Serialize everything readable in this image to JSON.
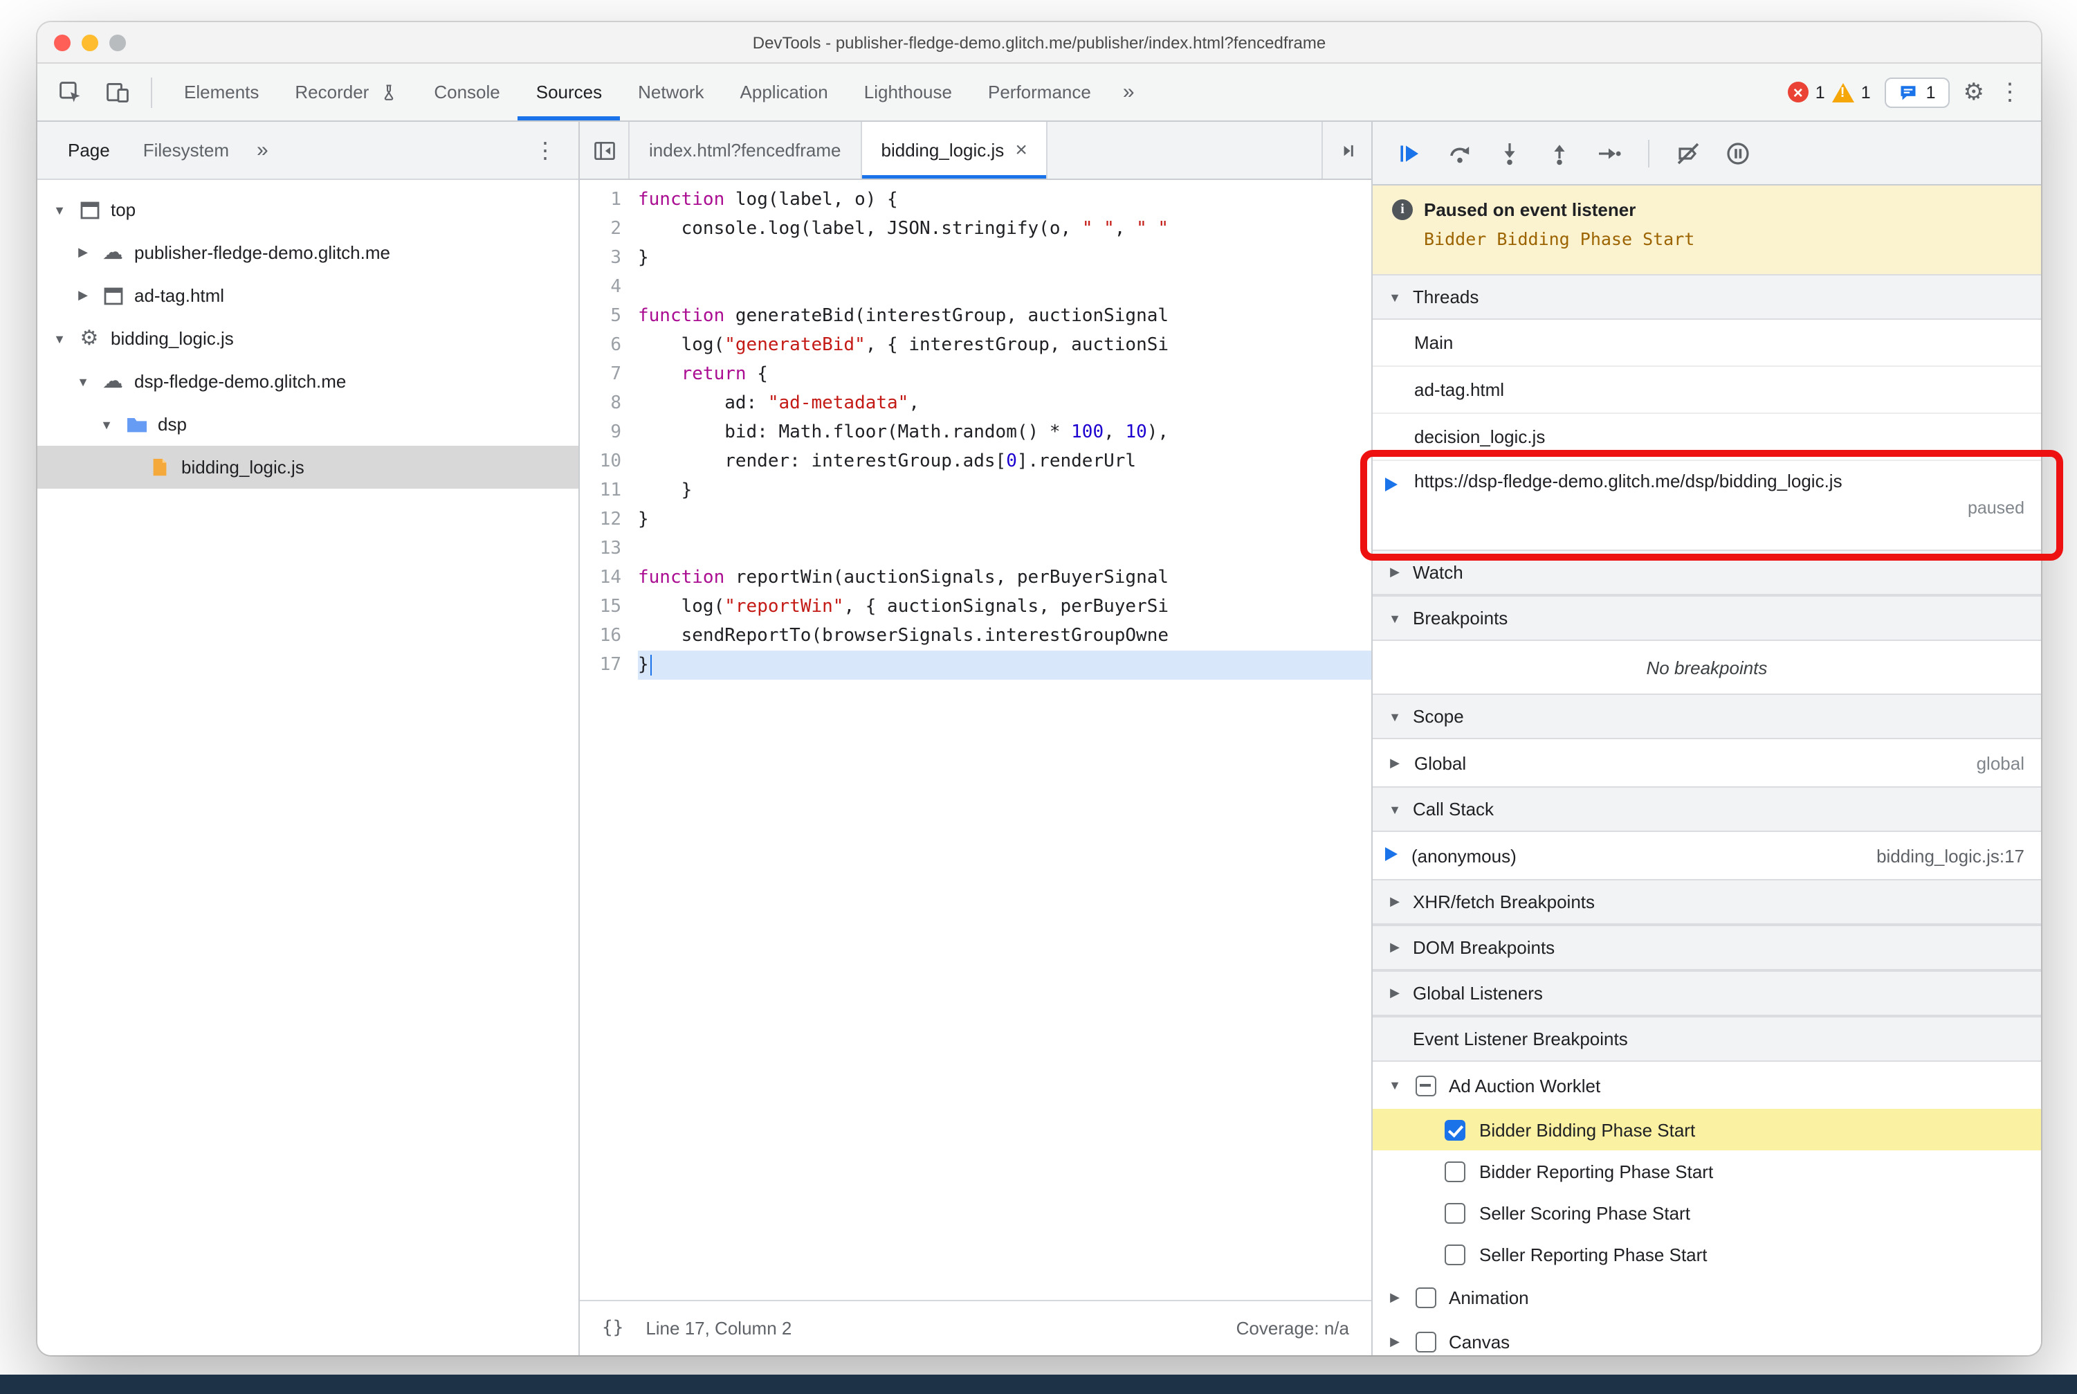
{
  "window": {
    "title": "DevTools - publisher-fledge-demo.glitch.me/publisher/index.html?fencedframe"
  },
  "icons": {
    "tri_down": "▼",
    "tri_right": "▶",
    "chevrons": "»",
    "kebab": "⋮",
    "close": "×",
    "cloud": "☁",
    "gear": "⚙",
    "braces": "{}"
  },
  "toolbar": {
    "tabs": [
      {
        "label": "Elements"
      },
      {
        "label": "Recorder"
      },
      {
        "label": "Console"
      },
      {
        "label": "Sources"
      },
      {
        "label": "Network"
      },
      {
        "label": "Application"
      },
      {
        "label": "Lighthouse"
      },
      {
        "label": "Performance"
      }
    ],
    "badges": {
      "errors": "1",
      "warnings": "1",
      "issues": "1"
    }
  },
  "navigator": {
    "tabs": [
      {
        "label": "Page"
      },
      {
        "label": "Filesystem"
      }
    ],
    "tree": [
      {
        "label": "top"
      },
      {
        "label": "publisher-fledge-demo.glitch.me"
      },
      {
        "label": "ad-tag.html"
      },
      {
        "label": "bidding_logic.js"
      },
      {
        "label": "dsp-fledge-demo.glitch.me"
      },
      {
        "label": "dsp"
      },
      {
        "label": "bidding_logic.js"
      }
    ]
  },
  "editor": {
    "tabs": [
      {
        "label": "index.html?fencedframe"
      },
      {
        "label": "bidding_logic.js"
      }
    ],
    "status": {
      "position": "Line 17, Column 2",
      "coverage": "Coverage: n/a"
    },
    "code": {
      "lines": [
        {
          "n": "1",
          "segs": [
            [
              "kw",
              "function"
            ],
            [
              "pl",
              " log(label, o) {"
            ]
          ]
        },
        {
          "n": "2",
          "segs": [
            [
              "pl",
              "    console.log(label, JSON.stringify(o, "
            ],
            [
              "str",
              "\" \""
            ],
            [
              "pl",
              ", "
            ],
            [
              "str",
              "\" \""
            ]
          ]
        },
        {
          "n": "3",
          "segs": [
            [
              "pl",
              "}"
            ]
          ]
        },
        {
          "n": "4",
          "segs": []
        },
        {
          "n": "5",
          "segs": [
            [
              "kw",
              "function"
            ],
            [
              "pl",
              " generateBid(interestGroup, auctionSignal"
            ]
          ]
        },
        {
          "n": "6",
          "segs": [
            [
              "pl",
              "    log("
            ],
            [
              "str",
              "\"generateBid\""
            ],
            [
              "pl",
              ", { interestGroup, auctionSi"
            ]
          ]
        },
        {
          "n": "7",
          "segs": [
            [
              "pl",
              "    "
            ],
            [
              "kw",
              "return"
            ],
            [
              "pl",
              " {"
            ]
          ]
        },
        {
          "n": "8",
          "segs": [
            [
              "pl",
              "        ad: "
            ],
            [
              "str",
              "\"ad-metadata\""
            ],
            [
              "pl",
              ","
            ]
          ]
        },
        {
          "n": "9",
          "segs": [
            [
              "pl",
              "        bid: Math.floor(Math.random() * "
            ],
            [
              "num",
              "100"
            ],
            [
              "pl",
              ", "
            ],
            [
              "num",
              "10"
            ],
            [
              "pl",
              "),"
            ]
          ]
        },
        {
          "n": "10",
          "segs": [
            [
              "pl",
              "        render: interestGroup.ads["
            ],
            [
              "num",
              "0"
            ],
            [
              "pl",
              "].renderUrl"
            ]
          ]
        },
        {
          "n": "11",
          "segs": [
            [
              "pl",
              "    }"
            ]
          ]
        },
        {
          "n": "12",
          "segs": [
            [
              "pl",
              "}"
            ]
          ]
        },
        {
          "n": "13",
          "segs": []
        },
        {
          "n": "14",
          "segs": [
            [
              "kw",
              "function"
            ],
            [
              "pl",
              " reportWin(auctionSignals, perBuyerSignal"
            ]
          ]
        },
        {
          "n": "15",
          "segs": [
            [
              "pl",
              "    log("
            ],
            [
              "str",
              "\"reportWin\""
            ],
            [
              "pl",
              ", { auctionSignals, perBuyerSi"
            ]
          ]
        },
        {
          "n": "16",
          "segs": [
            [
              "pl",
              "    sendReportTo(browserSignals.interestGroupOwne"
            ]
          ]
        },
        {
          "n": "17",
          "segs": [
            [
              "pl",
              "}"
            ]
          ],
          "hl": true
        }
      ]
    }
  },
  "sidebar": {
    "paused": {
      "title": "Paused on event listener",
      "reason": "Bidder Bidding Phase Start"
    },
    "threads": {
      "title": "Threads",
      "items": [
        {
          "label": "Main"
        },
        {
          "label": "ad-tag.html"
        },
        {
          "label": "decision_logic.js"
        }
      ],
      "active": {
        "url": "https://dsp-fledge-demo.glitch.me/dsp/bidding_logic.js",
        "status": "paused"
      }
    },
    "watch": {
      "title": "Watch"
    },
    "breakpoints": {
      "title": "Breakpoints",
      "empty": "No breakpoints"
    },
    "scope": {
      "title": "Scope",
      "global_label": "Global",
      "global_value": "global"
    },
    "callstack": {
      "title": "Call Stack",
      "frame": "(anonymous)",
      "location": "bidding_logic.js:17"
    },
    "xhr_title": "XHR/fetch Breakpoints",
    "dom_title": "DOM Breakpoints",
    "global_listeners_title": "Global Listeners",
    "elb": {
      "title": "Event Listener Breakpoints",
      "group": "Ad Auction Worklet",
      "items": [
        {
          "label": "Bidder Bidding Phase Start",
          "checked": true
        },
        {
          "label": "Bidder Reporting Phase Start",
          "checked": false
        },
        {
          "label": "Seller Scoring Phase Start",
          "checked": false
        },
        {
          "label": "Seller Reporting Phase Start",
          "checked": false
        }
      ],
      "groups_below": [
        {
          "label": "Animation"
        },
        {
          "label": "Canvas"
        }
      ]
    }
  },
  "colors": {
    "accent": "#1a73e8",
    "annotation": "#ee1111",
    "paused_banner": "#fbf2d0",
    "selected_breakpoint_row": "#fbf1a3"
  }
}
